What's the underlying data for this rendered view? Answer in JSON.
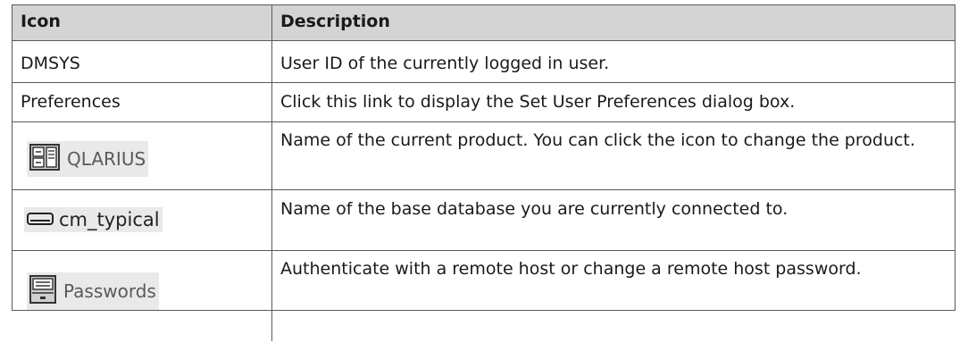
{
  "table": {
    "headers": {
      "icon": "Icon",
      "description": "Description"
    },
    "rows": [
      {
        "icon_text": "DMSYS",
        "description": "User ID of the currently logged in user."
      },
      {
        "icon_text": "Preferences",
        "description": "Click this link to display the Set User Preferences dialog box."
      },
      {
        "icon_label": "QLARIUS",
        "icon_name": "product-icon",
        "description": "Name of the current product. You can click the icon to change the product."
      },
      {
        "icon_label": "cm_typical",
        "icon_name": "database-icon",
        "description": "Name of the base database you are currently connected to."
      },
      {
        "icon_label": "Passwords",
        "icon_name": "passwords-icon",
        "description": "Authenticate with a remote host or change a remote host password."
      }
    ]
  }
}
